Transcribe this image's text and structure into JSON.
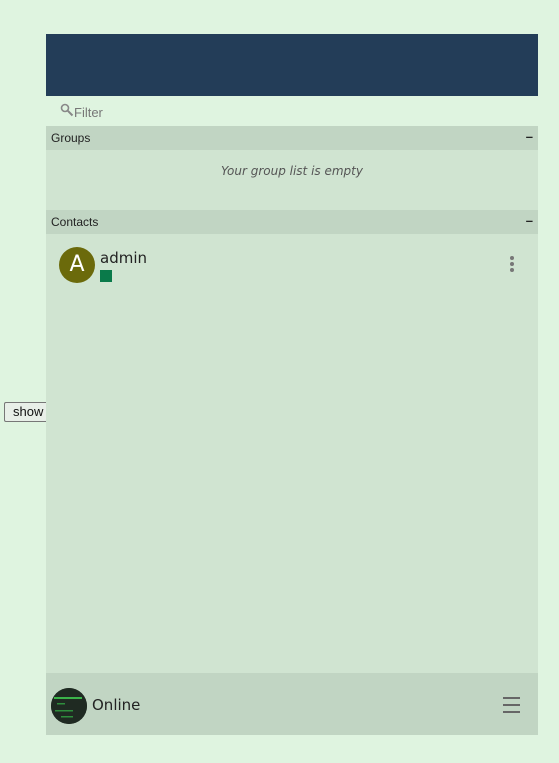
{
  "sidebar_toggle": {
    "label": "show"
  },
  "filter": {
    "placeholder": "Filter",
    "icon": "search-icon"
  },
  "groups": {
    "title": "Groups",
    "toggle": "–",
    "empty_message": "Your group list is empty"
  },
  "contacts": {
    "title": "Contacts",
    "toggle": "–",
    "items": [
      {
        "initial": "A",
        "name": "admin",
        "status_color": "#0a7a4a",
        "avatar_color": "#6b6a0b"
      }
    ]
  },
  "footer": {
    "status": "Online",
    "menu_icon": "hamburger-icon"
  },
  "colors": {
    "header": "#233d58",
    "panel": "#d0e4d1",
    "section_head": "#c1d5c3",
    "page_background": "#dff4e0"
  }
}
